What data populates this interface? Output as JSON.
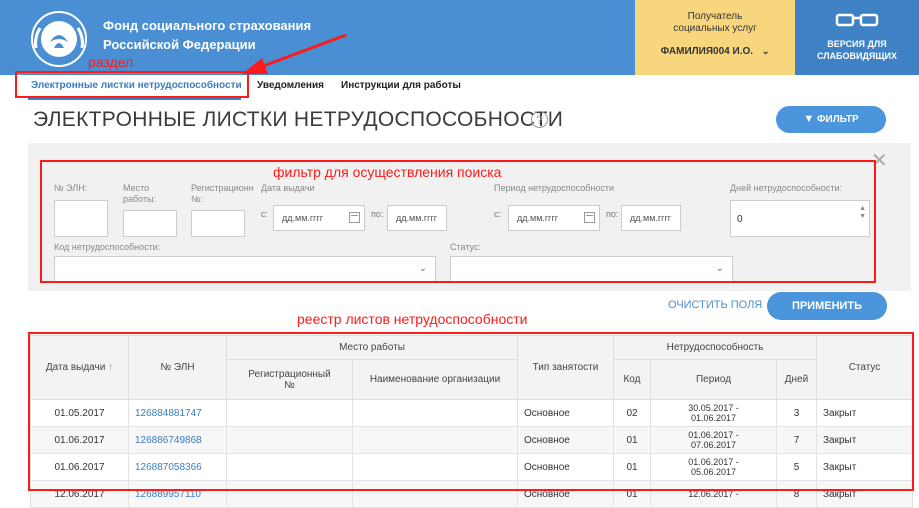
{
  "header": {
    "org_line1": "Фонд социального страхования",
    "org_line2": "Российской Федерации",
    "user_caption_line1": "Получатель",
    "user_caption_line2": "социальных услуг",
    "user_name": "ФАМИЛИЯ004 И.О.",
    "vision_line1": "ВЕРСИЯ ДЛЯ",
    "vision_line2": "СЛАБОВИДЯЩИХ",
    "colors": {
      "bar": "#4a8fd4",
      "user_box": "#f7d67d",
      "vision_box": "#3e81c5"
    }
  },
  "tabs": [
    {
      "label": "Электронные листки нетрудоспособности",
      "active": true
    },
    {
      "label": "Уведомления",
      "active": false
    },
    {
      "label": "Инструкции для работы",
      "active": false
    }
  ],
  "page": {
    "title": "ЭЛЕКТРОННЫЕ ЛИСТКИ НЕТРУДОСПОСОБНОСТИ",
    "help": "?",
    "filter_button": "ФИЛЬТР"
  },
  "filter": {
    "eln_label": "№ ЭЛН:",
    "workplace_label_1": "Место",
    "workplace_label_2": "работы:",
    "reg_label_1": "Регистрационн",
    "reg_label_2": "№:",
    "issue_date_label": "Дата выдачи",
    "period_label": "Период нетрудоспособности",
    "days_label": "Дней нетрудоспособности:",
    "from": "с:",
    "to": "по:",
    "date_placeholder": "дд.мм.гггг",
    "days_value": "0",
    "code_label": "Код нетрудоспособности:",
    "status_label": "Статус:",
    "clear_button": "ОЧИСТИТЬ ПОЛЯ",
    "apply_button": "ПРИМЕНИТЬ"
  },
  "annotations": {
    "section": "раздел",
    "filter_note": "фильтр для осуществления поиска",
    "registry_note": "реестр листов нетрудоспособности"
  },
  "table": {
    "headers": {
      "issue_date": "Дата выдачи",
      "sort": "↑",
      "eln": "№ ЭЛН",
      "workplace": "Место работы",
      "reg_no_1": "Регистрационный",
      "reg_no_2": "№",
      "org_name": "Наименование организации",
      "employment": "Тип занятости",
      "disability": "Нетрудоспособность",
      "code": "Код",
      "period": "Период",
      "days": "Дней",
      "status": "Статус"
    },
    "rows": [
      {
        "date": "01.05.2017",
        "eln": "126884881747",
        "reg": "",
        "org": "",
        "employment": "Основное",
        "code": "02",
        "p1": "30.05.2017 -",
        "p2": "01.06.2017",
        "days": "3",
        "status": "Закрыт"
      },
      {
        "date": "01.06.2017",
        "eln": "126886749868",
        "reg": "",
        "org": "",
        "employment": "Основное",
        "code": "01",
        "p1": "01.06.2017 -",
        "p2": "07.06.2017",
        "days": "7",
        "status": "Закрыт"
      },
      {
        "date": "01.06.2017",
        "eln": "126887058366",
        "reg": "",
        "org": "",
        "employment": "Основное",
        "code": "01",
        "p1": "01.06.2017 -",
        "p2": "05.06.2017",
        "days": "5",
        "status": "Закрыт"
      },
      {
        "date": "12.06.2017",
        "eln": "126889957110",
        "reg": "",
        "org": "",
        "employment": "Основное",
        "code": "01",
        "p1": "12.06.2017 -",
        "p2": "",
        "days": "8",
        "status": "Закрыт"
      }
    ]
  }
}
